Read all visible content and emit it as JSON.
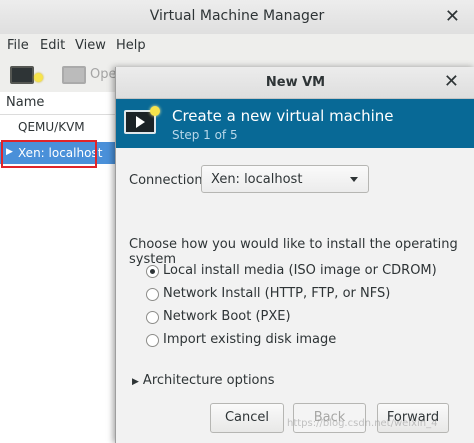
{
  "main_window": {
    "title": "Virtual Machine Manager",
    "menu": [
      "File",
      "Edit",
      "View",
      "Help"
    ],
    "toolbar": {
      "open_label": "Ope"
    },
    "list": {
      "header": "Name",
      "connections": [
        "QEMU/KVM",
        "Xen: localhost"
      ]
    }
  },
  "dialog": {
    "title": "New VM",
    "heading": "Create a new virtual machine",
    "step": "Step 1 of 5",
    "connection": {
      "label": "Connection:",
      "value": "Xen: localhost"
    },
    "question": "Choose how you would like to install the operating system",
    "install_options": [
      {
        "label": "Local install media (ISO image or CDROM)",
        "selected": true
      },
      {
        "label": "Network Install (HTTP, FTP, or NFS)",
        "selected": false
      },
      {
        "label": "Network Boot (PXE)",
        "selected": false
      },
      {
        "label": "Import existing disk image",
        "selected": false
      }
    ],
    "expander": "Architecture options",
    "buttons": {
      "cancel": "Cancel",
      "back": "Back",
      "forward": "Forward"
    }
  },
  "watermark": "https://blog.csdn.net/weixin_4",
  "colors": {
    "banner": "#086996",
    "selection": "#4a90d9",
    "highlight_box": "#e0242a"
  }
}
